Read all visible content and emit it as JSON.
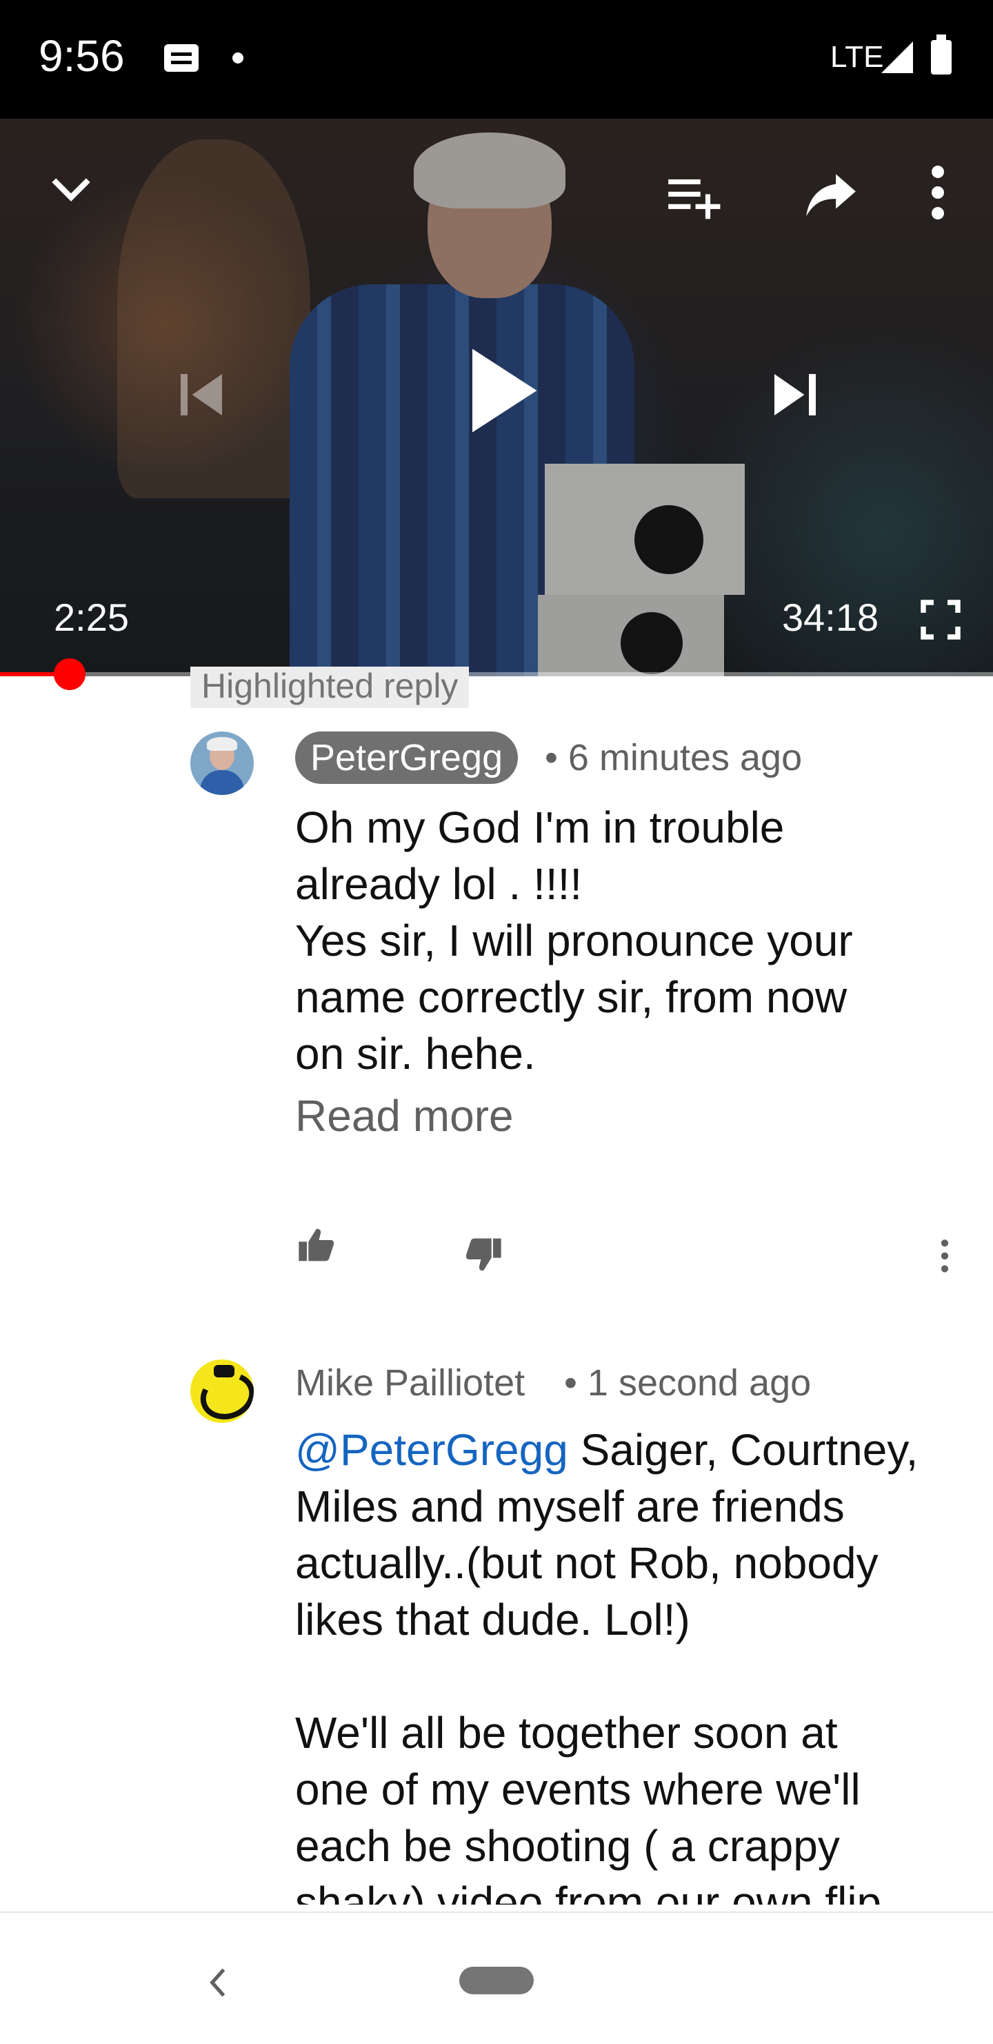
{
  "status_bar": {
    "time": "9:56",
    "network": "LTE",
    "icons": [
      "message-icon",
      "dot-icon",
      "signal-icon",
      "battery-icon"
    ]
  },
  "player": {
    "current_time": "2:25",
    "total_time": "34:18",
    "progress_fraction": 0.07,
    "icons": [
      "chevron-down-icon",
      "add-to-queue-icon",
      "share-icon",
      "more-vertical-icon",
      "previous-icon",
      "play-icon",
      "next-icon",
      "fullscreen-icon"
    ],
    "accent_color": "#ff0000"
  },
  "comments": {
    "highlight_label": "Highlighted reply",
    "items": [
      {
        "author": "PeterGregg",
        "time": "• 6 minutes ago",
        "text": "Oh my God I'm in trouble\nalready lol . !!!!\nYes sir, I will pronounce your\nname correctly sir, from now\non sir. hehe.",
        "read_more": "Read more"
      },
      {
        "author": "Mike Pailliotet",
        "time": "• 1 second ago",
        "mention": "@PeterGregg",
        "text": " Saiger, Courtney,\nMiles and myself are friends\nactually..(but not Rob, nobody\nlikes that dude. Lol!)\n\nWe'll all be together soon at\none of my events where we'll\neach be shooting ( a crappy\nshaky) video from our own flip"
      }
    ],
    "mention_color": "#1565c0"
  },
  "nav_bar": {
    "icons": [
      "back-icon",
      "home-pill-icon"
    ]
  }
}
